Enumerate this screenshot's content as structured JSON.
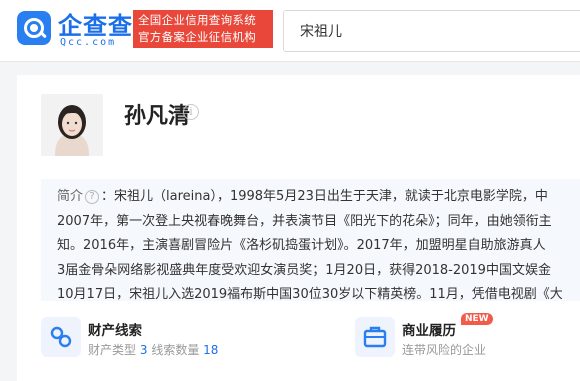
{
  "header": {
    "logo_text": "企查查",
    "logo_sub": "Qcc.com",
    "slogan_line1": "全国企业信用查询系统",
    "slogan_line2": "官方备案企业征信机构",
    "search_value": "宋祖儿"
  },
  "person": {
    "name": "孙凡清",
    "intro_label": "简介",
    "intro_lines": [
      "：宋祖儿（lareina），1998年5月23日出生于天津，就读于北京电影学院，中",
      "2007年，第一次登上央视春晚舞台，并表演节目《阳光下的花朵》；同年，由她领衔主",
      "知。2016年，主演喜剧冒险片《洛杉矶捣蛋计划》。2017年，加盟明星自助旅游真人",
      "3届金骨朵网络影视盛典年度受欢迎女演员奖；1月20日，获得2018-2019中国文娱金",
      "10月17日，宋祖儿入选2019福布斯中国30位30岁以下精英榜。11月，凭借电视剧《大"
    ]
  },
  "sections": [
    {
      "title": "财产线索",
      "meta_label1": "财产类型",
      "meta_value1": "3",
      "meta_label2": "线索数量",
      "meta_value2": "18",
      "icon": "link-icon"
    },
    {
      "title": "商业履历",
      "badge": "NEW",
      "meta_text": "连带风险的企业",
      "icon": "briefcase-icon"
    }
  ],
  "colors": {
    "brand": "#1b6fe8",
    "slogan_bg": "#e8473a",
    "badge": "#f25a4a"
  }
}
